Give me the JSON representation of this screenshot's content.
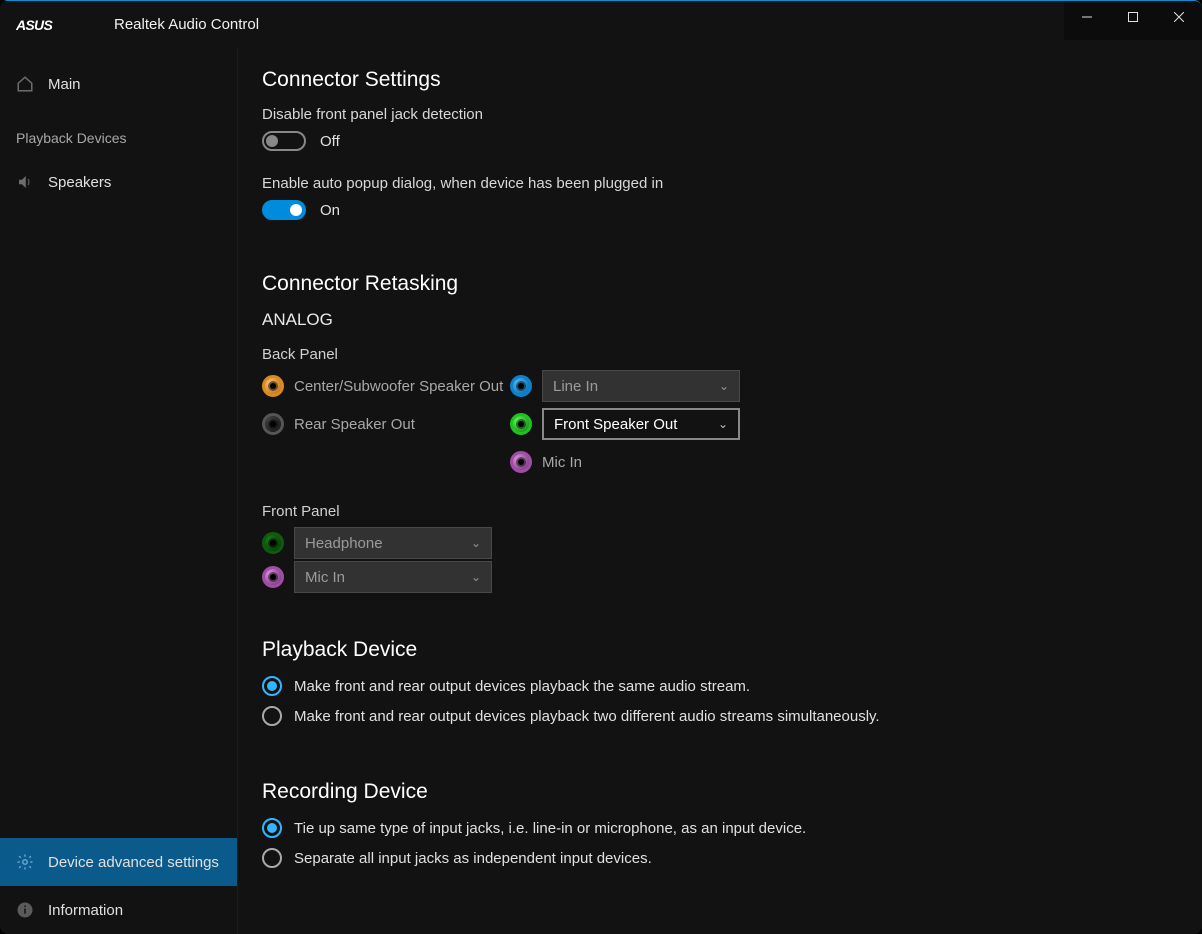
{
  "app": {
    "title": "Realtek Audio Control"
  },
  "sidebar": {
    "main": "Main",
    "playback_header": "Playback Devices",
    "speakers": "Speakers",
    "device_adv": "Device advanced settings",
    "information": "Information"
  },
  "connector_settings": {
    "title": "Connector Settings",
    "disable_front_jack": "Disable front panel jack detection",
    "off": "Off",
    "enable_popup": "Enable auto popup dialog, when device has been plugged in",
    "on": "On"
  },
  "retasking": {
    "title": "Connector Retasking",
    "analog": "ANALOG",
    "back_panel": "Back Panel",
    "front_panel": "Front Panel",
    "back_rows_left": [
      {
        "color": "orange",
        "label": "Center/Subwoofer Speaker Out"
      },
      {
        "color": "black",
        "label": "Rear Speaker Out"
      }
    ],
    "back_rows_right": [
      {
        "color": "blue",
        "label": "Line In",
        "combo": "Line In",
        "active": false
      },
      {
        "color": "green",
        "label": "Front Speaker Out",
        "combo": "Front Speaker Out",
        "active": true
      },
      {
        "color": "pink",
        "label": "Mic In",
        "combo": null
      }
    ],
    "front_rows": [
      {
        "color": "green-dark",
        "combo": "Headphone"
      },
      {
        "color": "pink",
        "combo": "Mic In"
      }
    ]
  },
  "playback_device": {
    "title": "Playback Device",
    "opt1": "Make front and rear output devices playback the same audio stream.",
    "opt2": "Make front and rear output devices playback two different audio streams simultaneously.",
    "selected": 0
  },
  "recording_device": {
    "title": "Recording Device",
    "opt1": "Tie up same type of input jacks, i.e. line-in or microphone, as an input device.",
    "opt2": "Separate all input jacks as independent input devices.",
    "selected": 0
  }
}
